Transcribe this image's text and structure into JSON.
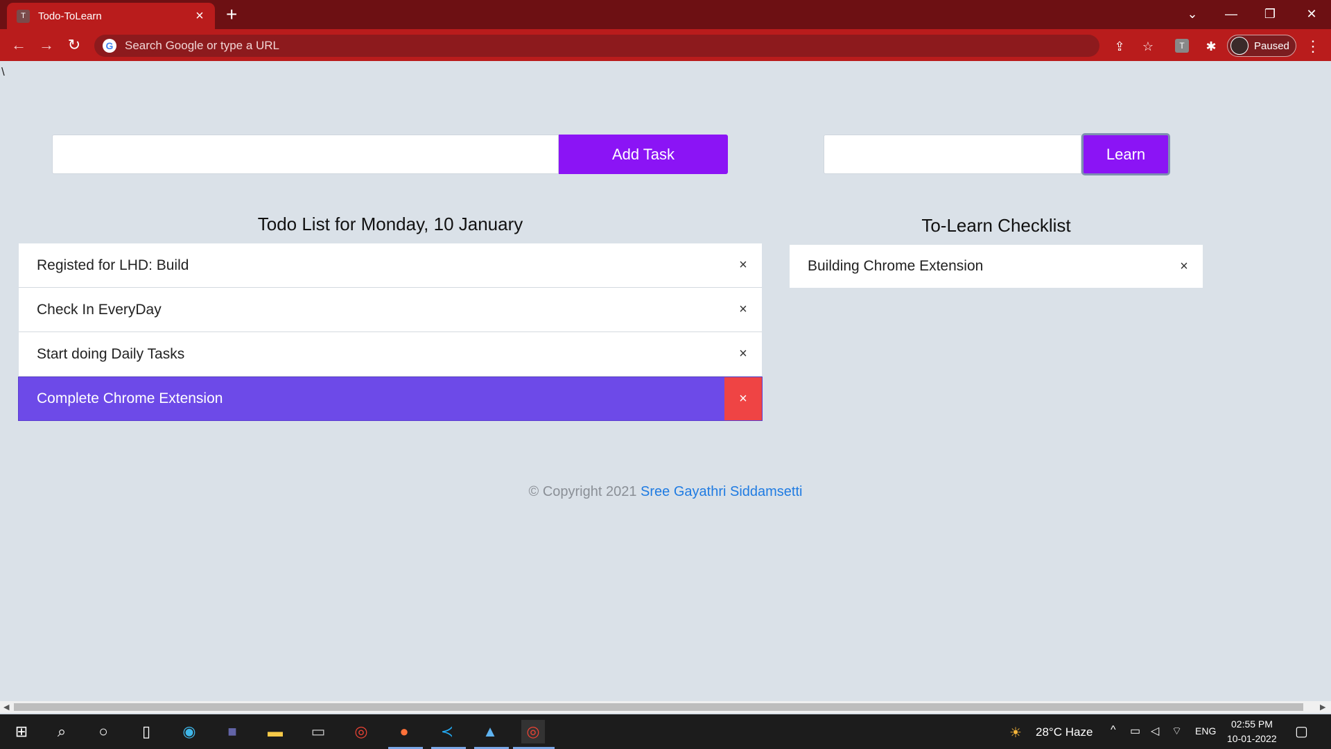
{
  "browser": {
    "tab_title": "Todo-ToLearn",
    "tab_favicon": "T",
    "tab_close": "×",
    "new_tab": "+",
    "omnibox_placeholder": "Search Google or type a URL",
    "profile_label": "Paused",
    "extension_label": "T",
    "icons": [
      "back-icon",
      "forward-icon",
      "reload-icon",
      "google-icon",
      "share-icon",
      "star-icon",
      "puzzle-icon",
      "more-icon"
    ]
  },
  "page": {
    "stray_text": "\\",
    "todo": {
      "input_value": "",
      "button_label": "Add Task",
      "title": "Todo List for Monday, 10 January",
      "items": [
        {
          "text": "Registed for LHD: Build",
          "close": "×"
        },
        {
          "text": "Check In EveryDay",
          "close": "×"
        },
        {
          "text": "Start doing Daily Tasks",
          "close": "×"
        },
        {
          "text": "Complete Chrome Extension",
          "close": "×",
          "active": true
        }
      ]
    },
    "learn": {
      "input_value": "",
      "button_label": "Learn",
      "title": "To-Learn Checklist",
      "items": [
        {
          "text": "Building Chrome Extension",
          "close": "×"
        }
      ]
    },
    "footer": {
      "prefix": "© Copyright 2021 ",
      "link": "Sree Gayathri Siddamsetti"
    }
  },
  "colors": {
    "tabbar": "#6d1013",
    "toolbar": "#b91c1c",
    "page_bg": "#dae1e8",
    "primary_button": "#8b14f5",
    "active_item": "#6d4ae8",
    "active_close": "#ef4444",
    "footer_link": "#1f7be2"
  },
  "taskbar": {
    "weather": "28°C  Haze",
    "language": "ENG",
    "time": "02:55 PM",
    "date": "10-01-2022"
  }
}
